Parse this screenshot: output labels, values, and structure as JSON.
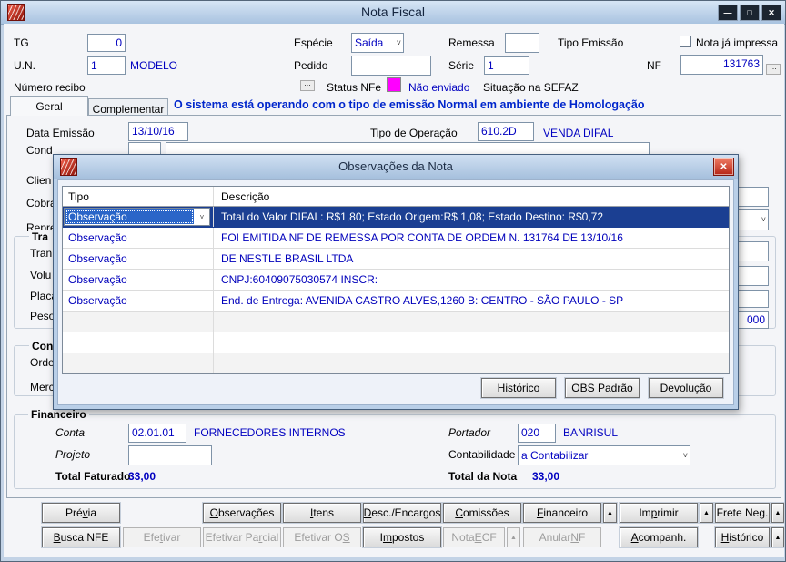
{
  "window": {
    "title": "Nota Fiscal"
  },
  "icons": {
    "minimize": "—",
    "maximize": "□",
    "close": "✕",
    "chevron": "˅",
    "ellipsis": "...",
    "up_arrow": "▲"
  },
  "status_color": "#ff00ff",
  "header": {
    "tg_label": "TG",
    "tg_value": "0",
    "un_label": "U.N.",
    "un_value": "1",
    "un_desc": "MODELO",
    "numero_recibo_label": "Número recibo",
    "especie_label": "Espécie",
    "especie_value": "Saída",
    "pedido_label": "Pedido",
    "pedido_value": "",
    "remessa_label": "Remessa",
    "remessa_value": "",
    "serie_label": "Série",
    "serie_value": "1",
    "tipo_emissao_label": "Tipo Emissão",
    "nota_impressa_label": "Nota já impressa",
    "nf_label": "NF",
    "nf_value": "131763",
    "status_nfe_label": "Status NFe",
    "status_nfe_value": "Não enviado",
    "situacao_label": "Situação na SEFAZ"
  },
  "tabs": {
    "geral": "Geral",
    "complementar": "Complementar",
    "ambiente_message": "O sistema está operando com o tipo de emissão Normal em ambiente de Homologação"
  },
  "geral": {
    "data_emissao_label": "Data Emissão",
    "data_emissao_value": "13/10/16",
    "tipo_operacao_label": "Tipo de Operação",
    "tipo_operacao_value": "610.2D",
    "tipo_operacao_desc": "VENDA DIFAL",
    "cut_labels": {
      "cond": "Cond",
      "cliente": "Clien",
      "cobranca": "Cobra",
      "representante": "Repre",
      "transporte_group": "Tra",
      "transportadora": "Tran",
      "volumes": "Volu",
      "placa": "Placa",
      "peso": "Peso",
      "con_group": "Con",
      "ordem": "Orde",
      "mercadoria": "Merc"
    },
    "peso_fragment": "000"
  },
  "financeiro": {
    "group_label": "Financeiro",
    "conta_label": "Conta",
    "conta_value": "02.01.01",
    "conta_desc": "FORNECEDORES INTERNOS",
    "projeto_label": "Projeto",
    "projeto_value": "",
    "portador_label": "Portador",
    "portador_value": "020",
    "portador_desc": "BANRISUL",
    "contabilidade_label": "Contabilidade",
    "contabilidade_value": "a Contabilizar",
    "total_faturado_label": "Total Faturado",
    "total_faturado_value": "33,00",
    "total_nota_label": "Total da Nota",
    "total_nota_value": "33,00"
  },
  "modal": {
    "title": "Observações da Nota",
    "table": {
      "headers": [
        "Tipo",
        "Descrição"
      ],
      "rows": [
        {
          "tipo": "Observação",
          "descricao": "Total do Valor DIFAL: R$1,80; Estado Origem:R$ 1,08; Estado Destino: R$0,72"
        },
        {
          "tipo": "Observação",
          "descricao": "FOI EMITIDA NF DE REMESSA POR CONTA DE ORDEM N. 131764 DE 13/10/16"
        },
        {
          "tipo": "Observação",
          "descricao": "DE NESTLE BRASIL LTDA"
        },
        {
          "tipo": "Observação",
          "descricao": "CNPJ:60409075030574 INSCR:"
        },
        {
          "tipo": "Observação",
          "descricao": "End. de Entrega: AVENIDA CASTRO ALVES,1260 B: CENTRO - SÃO PAULO - SP"
        }
      ]
    },
    "buttons": [
      "Histórico",
      "OBS Padrão",
      "Devolução"
    ]
  },
  "actions": {
    "row1": [
      {
        "label": "Prévia"
      },
      {
        "label": "Observações"
      },
      {
        "label": "Itens"
      },
      {
        "label": "Desc./Encargos"
      },
      {
        "label": "Comissões"
      },
      {
        "label": "Financeiro"
      },
      {
        "label": "Imprimir"
      },
      {
        "label": "Frete Neg."
      }
    ],
    "row2": [
      {
        "label": "Busca NFE"
      },
      {
        "label": "Efetivar"
      },
      {
        "label": "Efetivar Parcial"
      },
      {
        "label": "Efetivar OS"
      },
      {
        "label": "Impostos"
      },
      {
        "label": "Nota ECF"
      },
      {
        "label": "Anular NF"
      },
      {
        "label": "Acompanh."
      },
      {
        "label": "Histórico"
      }
    ]
  }
}
